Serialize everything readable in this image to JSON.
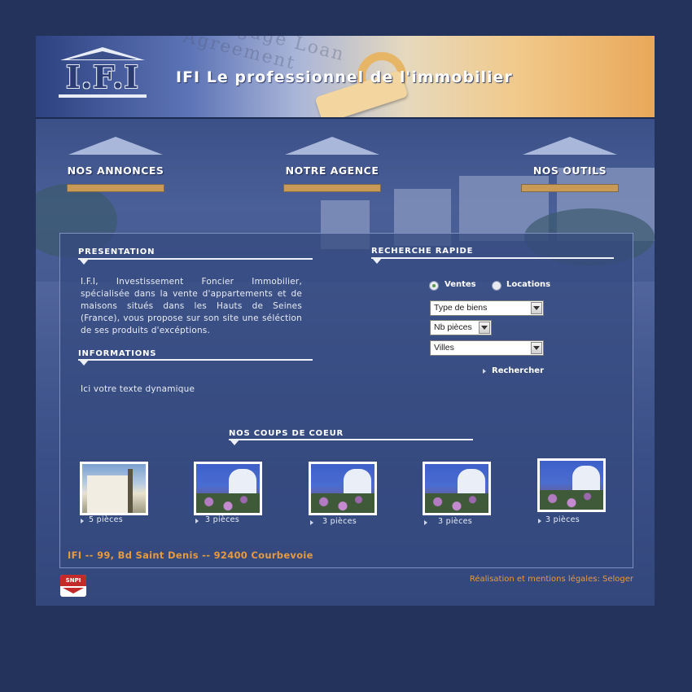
{
  "header": {
    "logo_text": "I.F.I",
    "tagline": "IFI  Le professionnel de l'immobilier",
    "paper_text": "Mortgage Loan Agreement"
  },
  "nav": [
    {
      "label": "NOS ANNONCES"
    },
    {
      "label": "NOTRE AGENCE"
    },
    {
      "label": "NOS OUTILS"
    }
  ],
  "presentation": {
    "title": "PRESENTATION",
    "text": "I.F.I, Investissement Foncier Immobilier, spécialisée dans la vente d'appartements et de maisons situés dans les Hauts de Seines (France), vous propose sur son site une séléction de ses produits d'excéptions."
  },
  "informations": {
    "title": "INFORMATIONS",
    "text": "Ici votre texte  dynamique"
  },
  "search": {
    "title": "RECHERCHE RAPIDE",
    "radio_sale": "Ventes",
    "radio_rent": "Locations",
    "select_type": "Type de biens",
    "select_rooms": "Nb pièces",
    "select_city": "Villes",
    "submit": "Rechercher"
  },
  "favorites": {
    "title": "NOS COUPS DE COEUR",
    "items": [
      {
        "label": "5 pièces",
        "image": "villa-photo"
      },
      {
        "label": "3 pièces",
        "image": "window-flowers-photo"
      },
      {
        "label": "3 pièces",
        "image": "window-flowers-photo"
      },
      {
        "label": "3 pièces",
        "image": "window-flowers-photo"
      },
      {
        "label": "3 pièces",
        "image": "window-flowers-photo"
      }
    ]
  },
  "footer": {
    "address": "IFI -- 99, Bd Saint Denis -- 92400 Courbevoie",
    "credits": "Réalisation et mentions légales: Seloger",
    "badge": "SNPI"
  },
  "colors": {
    "page_bg": "#23335c",
    "frame_bg": "#34497e",
    "accent_orange": "#e59a40",
    "nav_bar": "#c99a55"
  }
}
